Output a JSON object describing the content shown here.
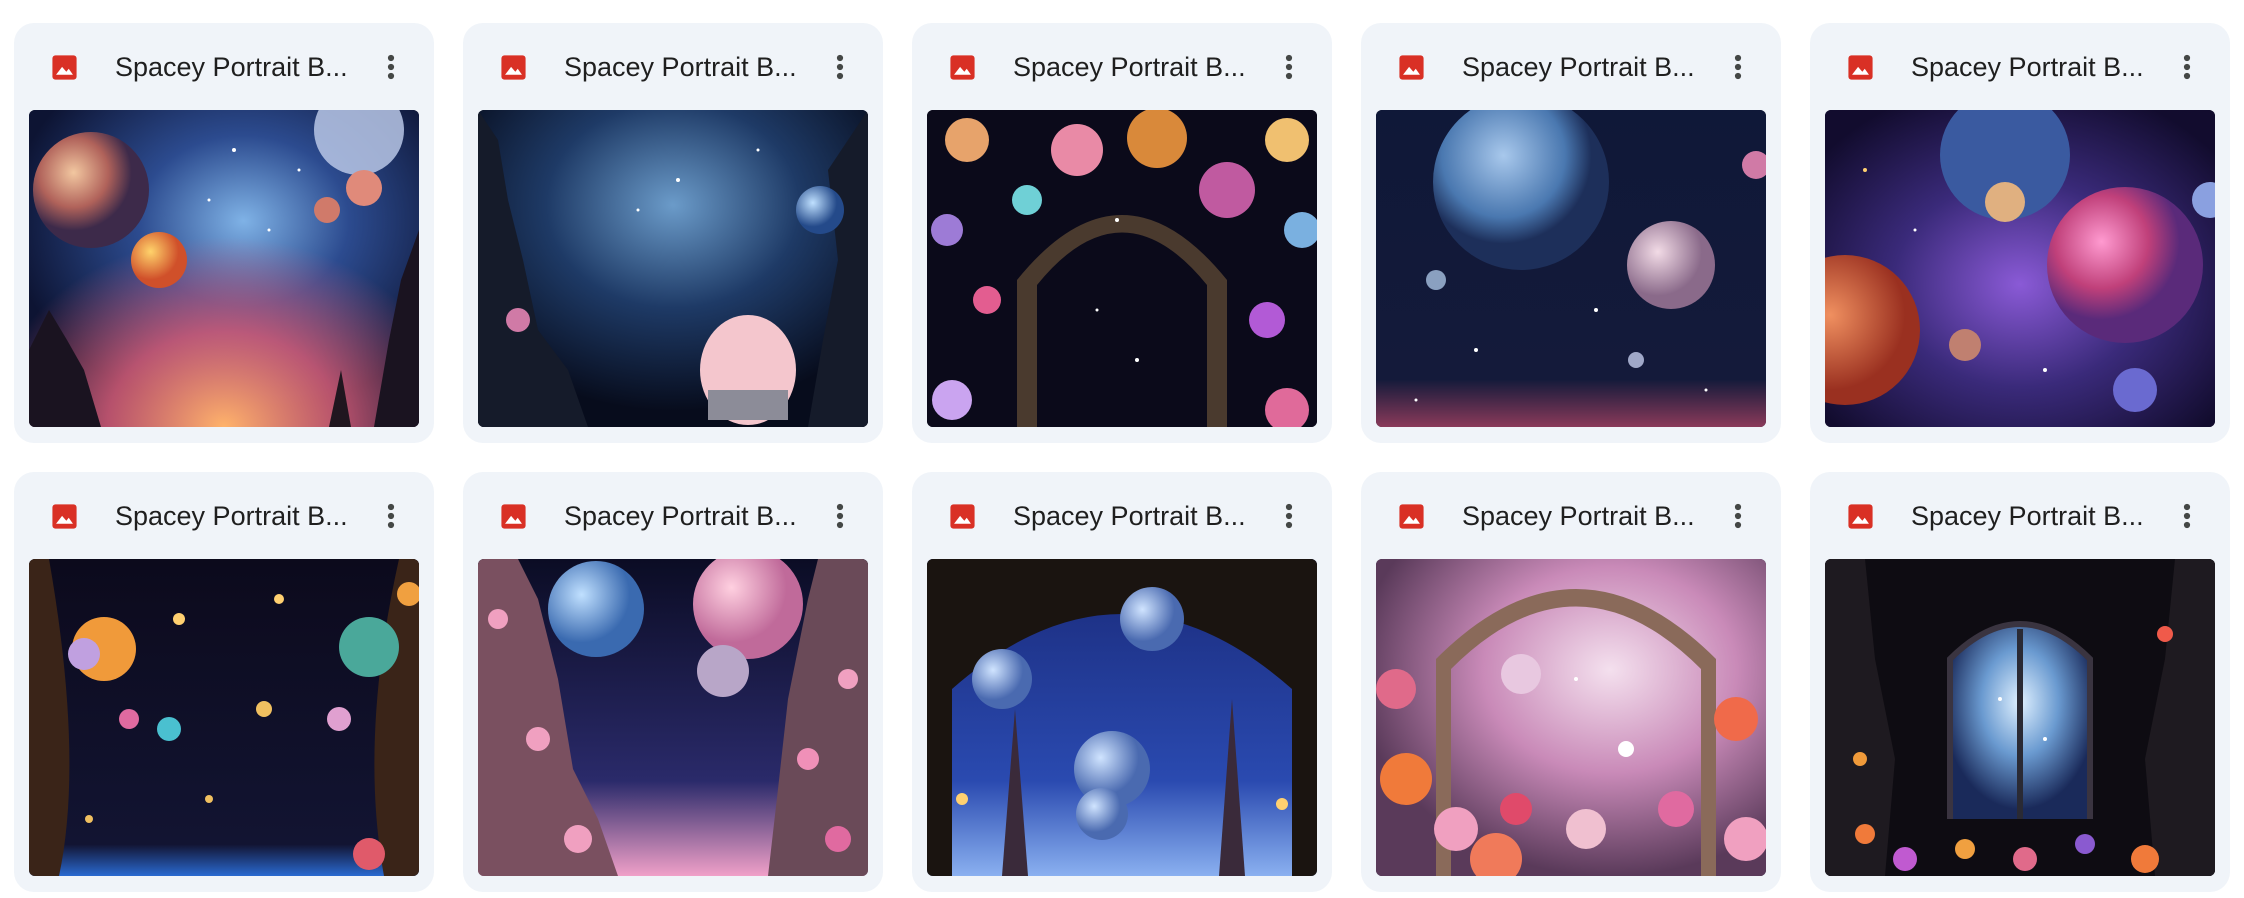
{
  "files": [
    {
      "name": "Spacey Portrait B...",
      "icon": "image-file-icon",
      "theme": "nebula-planets-rocks"
    },
    {
      "name": "Spacey Portrait B...",
      "icon": "image-file-icon",
      "theme": "chair-in-space-cave"
    },
    {
      "name": "Spacey Portrait B...",
      "icon": "image-file-icon",
      "theme": "planet-arch-orbs"
    },
    {
      "name": "Spacey Portrait B...",
      "icon": "image-file-icon",
      "theme": "blue-giant-planet"
    },
    {
      "name": "Spacey Portrait B...",
      "icon": "image-file-icon",
      "theme": "purple-planets-galaxy"
    },
    {
      "name": "Spacey Portrait B...",
      "icon": "image-file-icon",
      "theme": "curtains-glowing-orbs"
    },
    {
      "name": "Spacey Portrait B...",
      "icon": "image-file-icon",
      "theme": "cliffs-pink-planets"
    },
    {
      "name": "Spacey Portrait B...",
      "icon": "image-file-icon",
      "theme": "eiffel-towers-arch"
    },
    {
      "name": "Spacey Portrait B...",
      "icon": "image-file-icon",
      "theme": "flowers-pink-cosmos"
    },
    {
      "name": "Spacey Portrait B...",
      "icon": "image-file-icon",
      "theme": "window-dark-flowers"
    }
  ],
  "colors": {
    "card_bg": "#f0f4f9",
    "icon_red": "#d93025",
    "text": "#1f1f1f",
    "menu_dots": "#444746"
  },
  "more_icon": "more-vertical-icon"
}
